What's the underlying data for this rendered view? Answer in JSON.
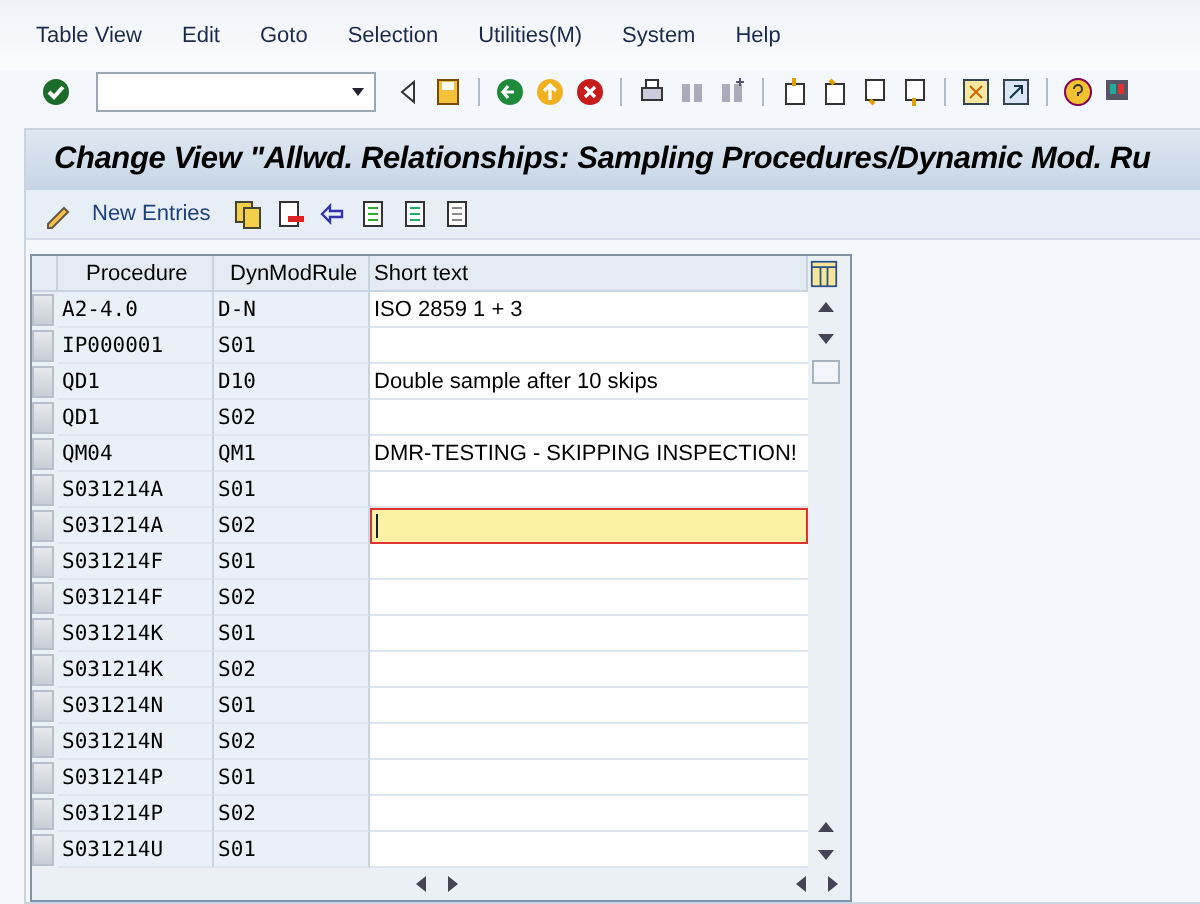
{
  "menu": [
    {
      "label": "Table View"
    },
    {
      "label": "Edit"
    },
    {
      "label": "Goto"
    },
    {
      "label": "Selection"
    },
    {
      "label": "Utilities(M)"
    },
    {
      "label": "System"
    },
    {
      "label": "Help"
    }
  ],
  "title": "Change View \"Allwd. Relationships: Sampling Procedures/Dynamic Mod. Ru",
  "app_toolbar": {
    "new_entries": "New Entries"
  },
  "table": {
    "columns": [
      "Procedure",
      "DynModRule",
      "Short text"
    ],
    "rows": [
      {
        "procedure": "A2-4.0",
        "rule": "D-N",
        "short_text": "ISO 2859 1 + 3",
        "focused": false
      },
      {
        "procedure": "IP000001",
        "rule": "S01",
        "focused": false
      },
      {
        "procedure": "QD1",
        "rule": "D10",
        "short_text": "Double sample after 10 skips",
        "focused": false
      },
      {
        "procedure": "QD1",
        "rule": "S02",
        "focused": false
      },
      {
        "procedure": "QM04",
        "rule": "QM1",
        "short_text": "DMR-TESTING - SKIPPING INSPECTION!",
        "focused": false
      },
      {
        "procedure": "S031214A",
        "rule": "S01",
        "focused": false
      },
      {
        "procedure": "S031214A",
        "rule": "S02",
        "focused": true
      },
      {
        "procedure": "S031214F",
        "rule": "S01",
        "focused": false
      },
      {
        "procedure": "S031214F",
        "rule": "S02",
        "focused": false
      },
      {
        "procedure": "S031214K",
        "rule": "S01",
        "focused": false
      },
      {
        "procedure": "S031214K",
        "rule": "S02",
        "focused": false
      },
      {
        "procedure": "S031214N",
        "rule": "S01",
        "focused": false
      },
      {
        "procedure": "S031214N",
        "rule": "S02",
        "focused": false
      },
      {
        "procedure": "S031214P",
        "rule": "S01",
        "focused": false
      },
      {
        "procedure": "S031214P",
        "rule": "S02",
        "focused": false
      },
      {
        "procedure": "S031214U",
        "rule": "S01",
        "focused": false
      }
    ]
  }
}
